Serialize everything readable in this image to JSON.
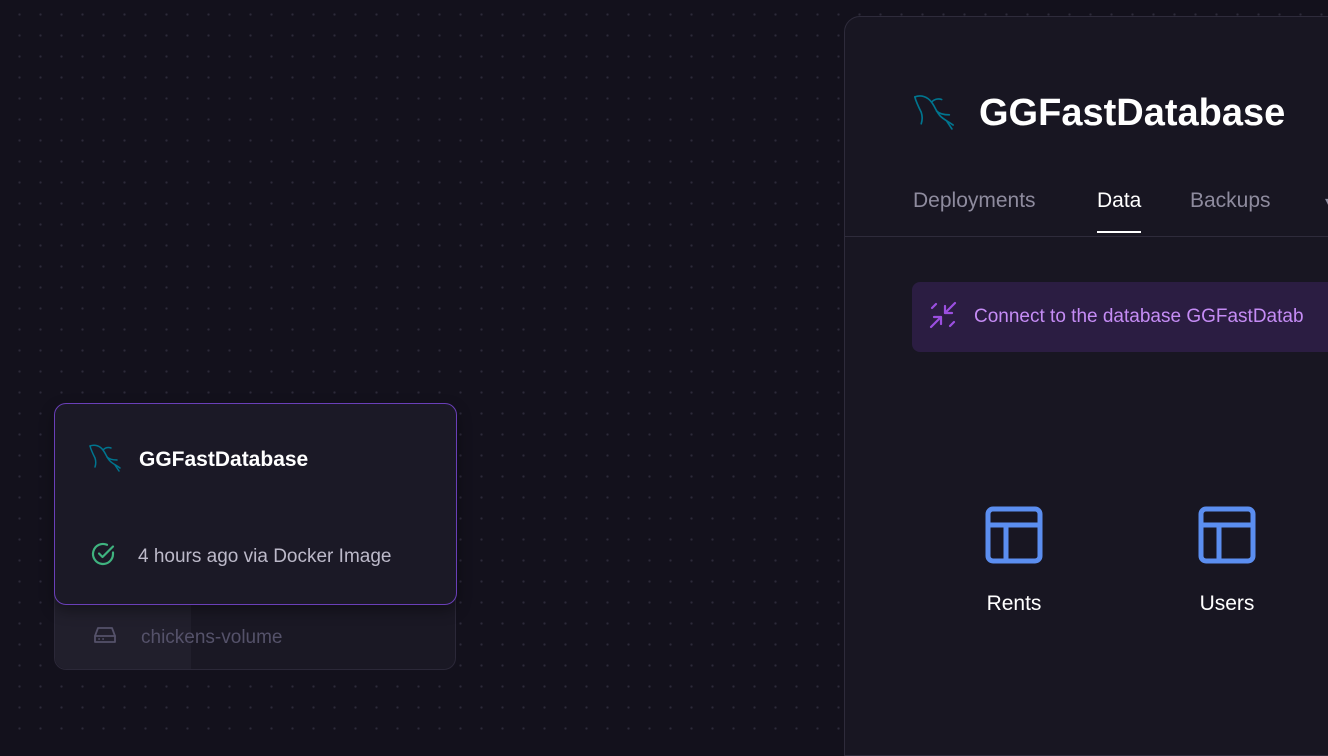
{
  "canvas": {
    "service": {
      "name": "GGFastDatabase",
      "status_text": "4 hours ago via Docker Image",
      "icon": "mysql-dolphin-icon",
      "status_icon": "check-circle-icon",
      "status_color": "#3fb37f"
    },
    "volume": {
      "name": "chickens-volume",
      "icon": "hard-drive-icon"
    }
  },
  "panel": {
    "title": "GGFastDatabase",
    "icon": "mysql-dolphin-icon",
    "tabs": [
      {
        "label": "Deployments",
        "active": false
      },
      {
        "label": "Data",
        "active": true
      },
      {
        "label": "Backups",
        "active": false
      }
    ],
    "connect_banner": {
      "text": "Connect to the database GGFastDatab",
      "icon": "connect-arrows-icon",
      "color": "#c58cf5"
    },
    "tables": [
      {
        "label": "Rents",
        "icon": "table-icon"
      },
      {
        "label": "Users",
        "icon": "table-icon"
      }
    ]
  },
  "colors": {
    "background": "#13111c",
    "accent": "#6a3fb8",
    "table_icon": "#5b8ef0",
    "mysql_blue": "#00758f"
  }
}
